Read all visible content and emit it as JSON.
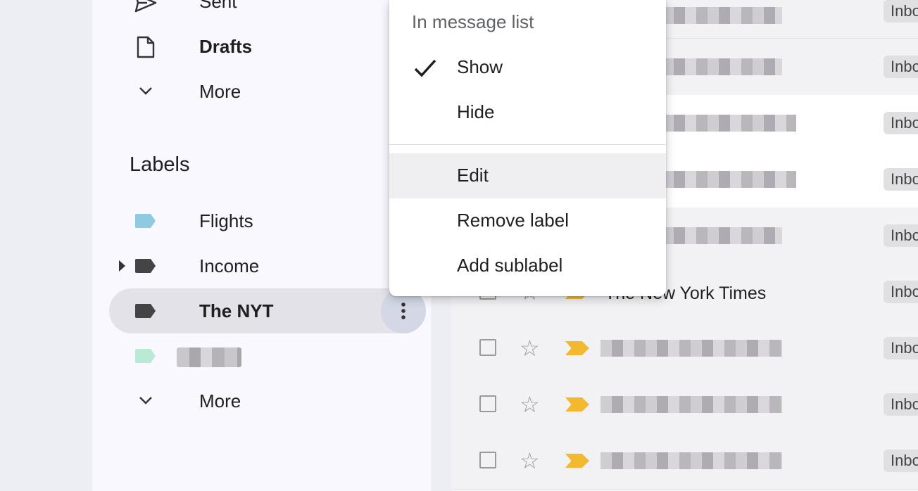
{
  "sidebar": {
    "sent_label": "Sent",
    "drafts_label": "Drafts",
    "more_label_top": "More",
    "labels_heading": "Labels",
    "labels": [
      {
        "name": "Flights",
        "color": "#8ecbe3"
      },
      {
        "name": "Income",
        "color": "#444446"
      },
      {
        "name": "The NYT",
        "color": "#444446"
      },
      {
        "name": "",
        "color": "#b9ead6"
      }
    ],
    "more_label_bottom": "More"
  },
  "menu": {
    "heading": "In message list",
    "items": [
      "Show",
      "Hide",
      "Edit",
      "Remove label",
      "Add sublabel"
    ],
    "checked_item": "Show",
    "hovered_item": "Edit"
  },
  "mail": {
    "visible_sender": "The New York Times",
    "row_chip": "Inbox"
  },
  "colors": {
    "accent_selected": "#e2e2e8",
    "important_marker": "#f2b830"
  }
}
